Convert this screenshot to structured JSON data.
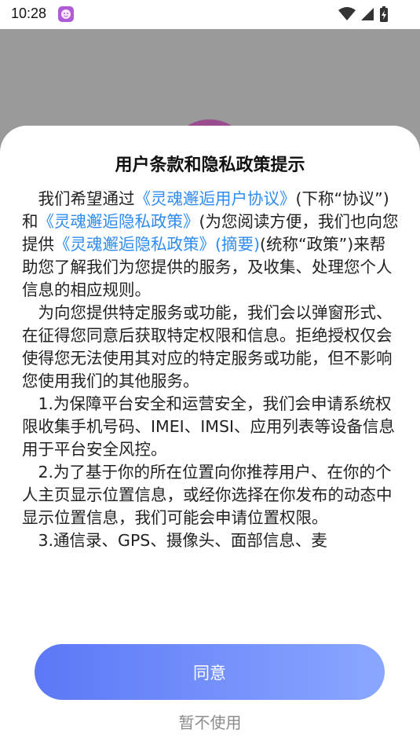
{
  "status_bar": {
    "time": "10:28",
    "icons": [
      "wifi-icon",
      "signal-icon",
      "battery-icon"
    ]
  },
  "dialog": {
    "title": "用户条款和隐私政策提示",
    "p1": {
      "t1": "我们希望通过",
      "link1": "《灵魂邂逅用户协议》",
      "t2": "(下称“协议”)和",
      "link2": "《灵魂邂逅隐私政策》",
      "t3": "(为您阅读方便，我们也向您提供",
      "link3": "《灵魂邂逅隐私政策》(摘要)",
      "t4": "(统称“政策”)来帮助您了解我们为您提供的服务，及收集、处理您个人信息的相应规则。"
    },
    "p2": "为向您提供特定服务或功能，我们会以弹窗形式、在征得您同意后获取特定权限和信息。拒绝授权仅会使得您无法使用其对应的特定服务或功能，但不影响您使用我们的其他服务。",
    "p3": "1.为保障平台安全和运营安全，我们会申请系统权限收集手机号码、IMEI、IMSI、应用列表等设备信息用于平台安全风控。",
    "p4": "2.为了基于你的所在位置向你推荐用户、在你的个人主页显示位置信息，或经你选择在你发布的动态中显示位置信息，我们可能会申请位置权限。",
    "p5": "3.通信录、GPS、摄像头、面部信息、麦",
    "agree_label": "同意",
    "decline_label": "暂不使用"
  },
  "colors": {
    "link": "#2f8cf0",
    "button_start": "#5c78f6",
    "button_end": "#8aa7ff",
    "backdrop": "#9a9a9a"
  }
}
